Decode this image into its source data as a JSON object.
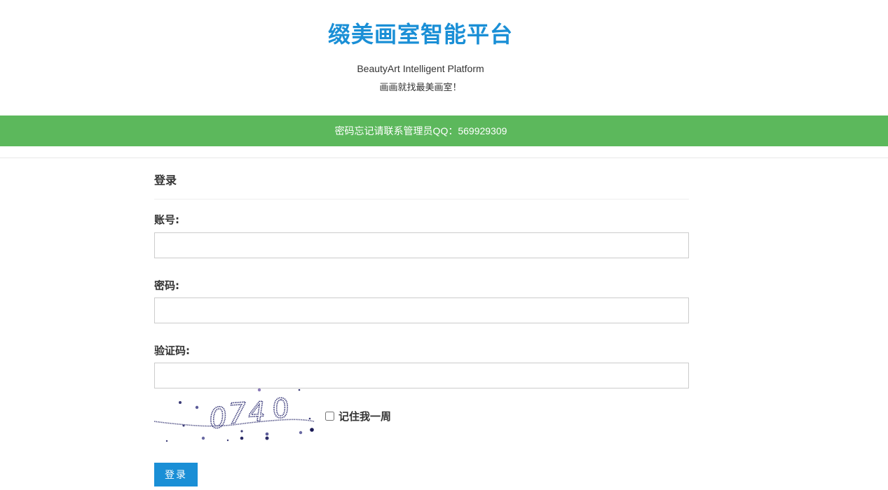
{
  "header": {
    "title": "缀美画室智能平台",
    "subtitle_en": "BeautyArt Intelligent Platform",
    "subtitle_cn": "画画就找最美画室！"
  },
  "notice": {
    "text": "密码忘记请联系管理员QQ：569929309",
    "color": "#5cb85c"
  },
  "login_form": {
    "heading": "登录",
    "account_label": "账号:",
    "account_value": "",
    "password_label": "密码:",
    "password_value": "",
    "captcha_label": "验证码:",
    "captcha_value": "",
    "captcha_text": "0740",
    "remember_label": "记住我一周",
    "remember_checked": false,
    "submit_label": "登录"
  },
  "colors": {
    "accent": "#1a8fd6",
    "notice": "#5cb85c"
  }
}
